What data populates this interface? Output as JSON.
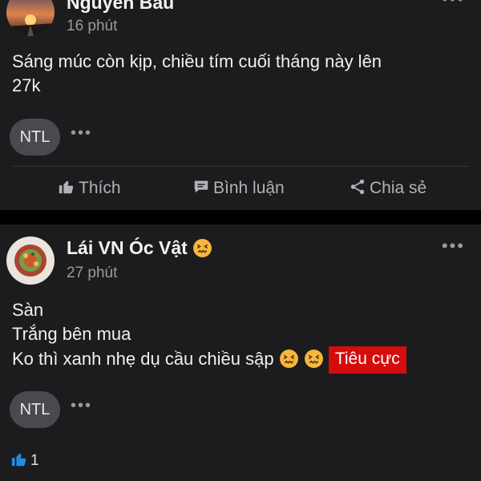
{
  "post1": {
    "author": "Nguyen Bau",
    "time": "16 phút",
    "more_icon": "more-horizontal-icon",
    "text_lines": [
      "Sáng múc còn kịp, chiều tím cuối tháng này lên",
      "27k"
    ],
    "reply_avatar_label": "NTL",
    "actions": {
      "like": "Thích",
      "comment": "Bình luận",
      "share": "Chia sẻ"
    }
  },
  "post2": {
    "author": "Lái VN Óc Vật",
    "time": "27 phút",
    "text_lines": [
      "Sàn",
      "Trắng bên mua",
      "Ko thì xanh nhẹ dụ cầu chiều sập"
    ],
    "tag": "Tiêu cực",
    "tag_color": "#d40c0c",
    "reply_avatar_label": "NTL",
    "like_count": "1"
  },
  "colors": {
    "card_bg": "#1c1c1e",
    "page_bg": "#000000",
    "accent_like": "#1f8ce6"
  }
}
